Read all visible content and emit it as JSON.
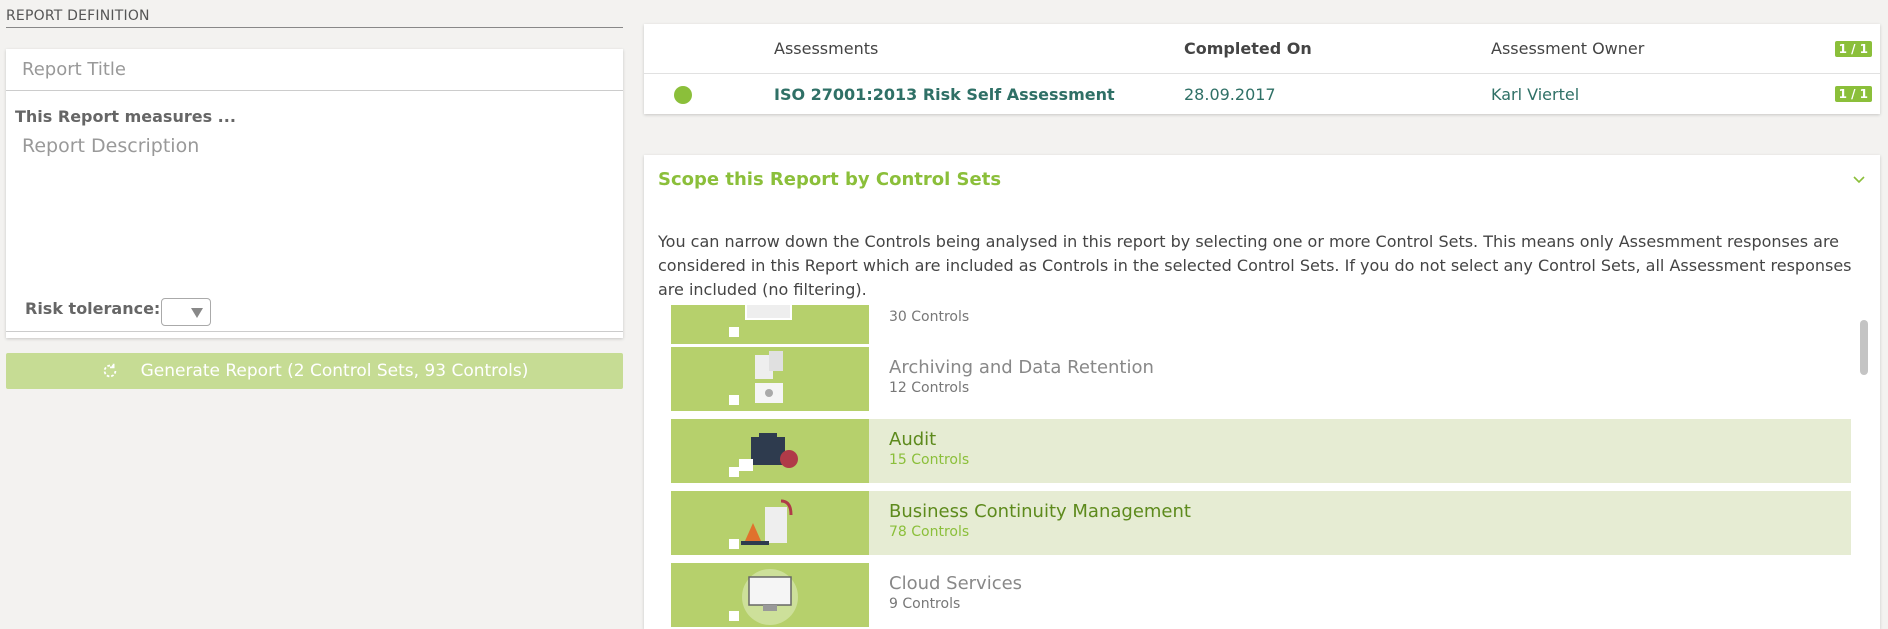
{
  "report_definition": {
    "section_title": "REPORT DEFINITION",
    "title_placeholder": "Report Title",
    "measures_label": "This Report measures ...",
    "description_placeholder": "Report Description",
    "risk_tolerance_label": "Risk tolerance:",
    "generate_button": "Generate Report (2 Control Sets, 93 Controls)"
  },
  "assessments": {
    "headers": {
      "assessments": "Assessments",
      "completed_on": "Completed On",
      "owner": "Assessment Owner",
      "count": "1 / 1"
    },
    "rows": [
      {
        "name": "ISO 27001:2013 Risk Self Assessment",
        "completed_on": "28.09.2017",
        "owner": "Karl Viertel",
        "count": "1 / 1",
        "status_color": "#8bbf3a"
      }
    ]
  },
  "scope": {
    "title": "Scope this Report by Control Sets",
    "description": "You can narrow down the Controls being analysed in this report by selecting one or more Control Sets. This means only Assesmment responses are considered in this Report which are included as Controls in the selected Control Sets. If you do not select any Control Sets, all Assessment responses are included (no filtering).",
    "control_sets": [
      {
        "name": "",
        "count": "30 Controls",
        "selected": false,
        "icon": "app-icon"
      },
      {
        "name": "Archiving and Data Retention",
        "count": "12 Controls",
        "selected": false,
        "icon": "archive-icon"
      },
      {
        "name": "Audit",
        "count": "15 Controls",
        "selected": true,
        "icon": "audit-icon"
      },
      {
        "name": "Business Continuity Management",
        "count": "78 Controls",
        "selected": true,
        "icon": "business-continuity-icon"
      },
      {
        "name": "Cloud Services",
        "count": "9 Controls",
        "selected": false,
        "icon": "cloud-icon"
      }
    ]
  },
  "colors": {
    "accent": "#8bbf3a",
    "accent_light": "#c6dc94",
    "thumb": "#b6d06c",
    "selected_row": "#e6ecd3",
    "teal_text": "#2f7066"
  }
}
